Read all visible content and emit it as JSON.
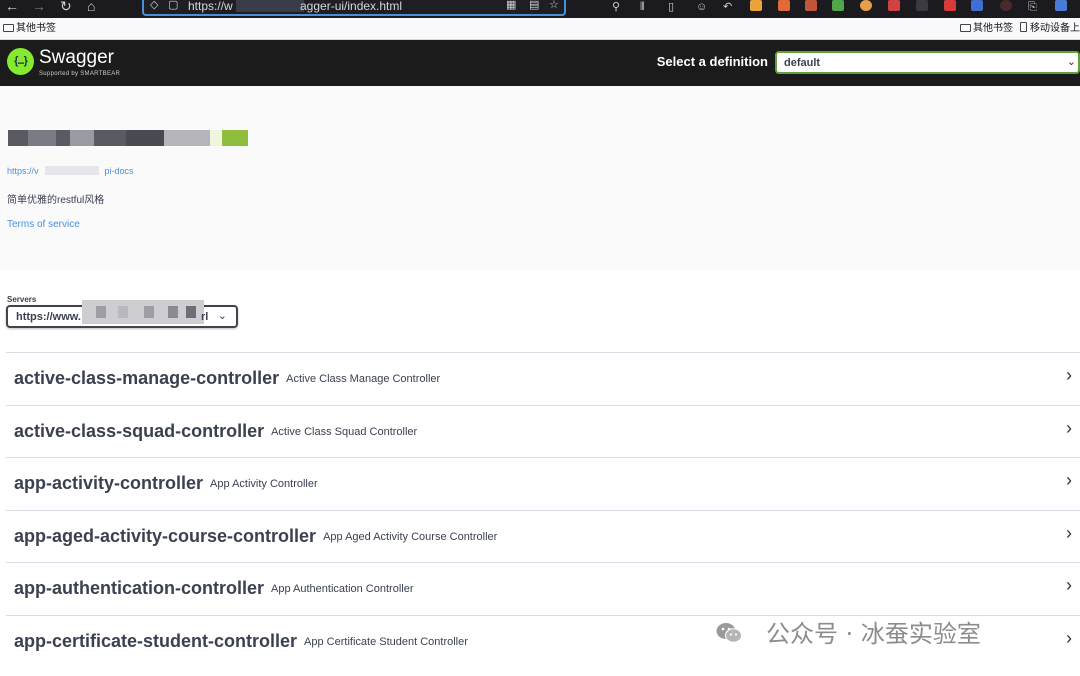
{
  "browser": {
    "url_start": "https://w",
    "url_end": "agger-ui/index.html",
    "bookmark_left": "其他书签",
    "bookmark_right_1": "其他书签",
    "bookmark_right_2": "移动设备上的"
  },
  "topbar": {
    "logo_name": "Swagger",
    "logo_sub": "Supported by SMARTBEAR",
    "logo_glyph": "{...}",
    "select_label": "Select a definition",
    "select_value": "default"
  },
  "info": {
    "url_start": "https://v",
    "url_end": "pi-docs",
    "description": "简单优雅的restful风格",
    "terms": "Terms of service"
  },
  "servers": {
    "label": "Servers",
    "value_start": "https://www.",
    "value_end": "rl"
  },
  "tags": [
    {
      "name": "active-class-manage-controller",
      "description": "Active Class Manage Controller"
    },
    {
      "name": "active-class-squad-controller",
      "description": "Active Class Squad Controller"
    },
    {
      "name": "app-activity-controller",
      "description": "App Activity Controller"
    },
    {
      "name": "app-aged-activity-course-controller",
      "description": "App Aged Activity Course Controller"
    },
    {
      "name": "app-authentication-controller",
      "description": "App Authentication Controller"
    },
    {
      "name": "app-certificate-student-controller",
      "description": "App Certificate Student Controller"
    }
  ],
  "watermark": {
    "text": "公众号 · 冰蚕实验室"
  },
  "colors": {
    "topbar_bg": "#1b1b1b",
    "logo_green": "#85ea2d",
    "select_border": "#62a03f",
    "link_blue": "#4990e2",
    "text": "#3b4151"
  }
}
